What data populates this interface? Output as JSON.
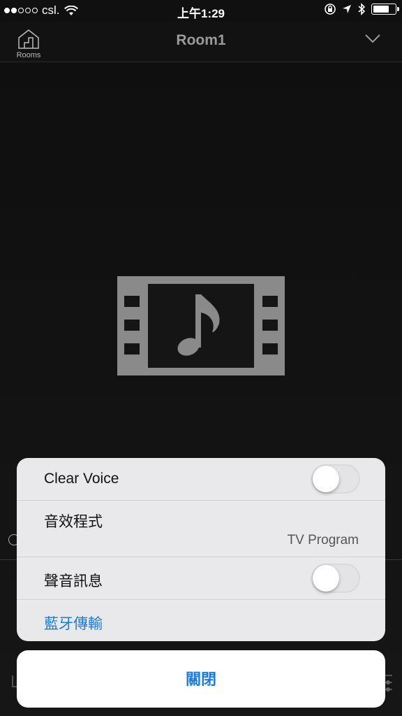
{
  "status_bar": {
    "carrier": "csl.",
    "time": "上午1:29"
  },
  "header": {
    "rooms_label": "Rooms",
    "title": "Room1"
  },
  "sheet": {
    "clear_voice": {
      "label": "Clear Voice",
      "on": false
    },
    "sound_program": {
      "label": "音效程式",
      "value": "TV Program"
    },
    "voice_guidance": {
      "label": "聲音訊息",
      "on": false
    },
    "bluetooth": {
      "label": "藍牙傳輸"
    }
  },
  "close_label": "關閉",
  "colors": {
    "accent": "#1b7be0",
    "sheet_bg": "#e9e9eb",
    "background": "#101010"
  },
  "icons": {
    "media": "film-music-icon",
    "rooms": "house-icon",
    "chevron": "chevron-down-icon"
  }
}
